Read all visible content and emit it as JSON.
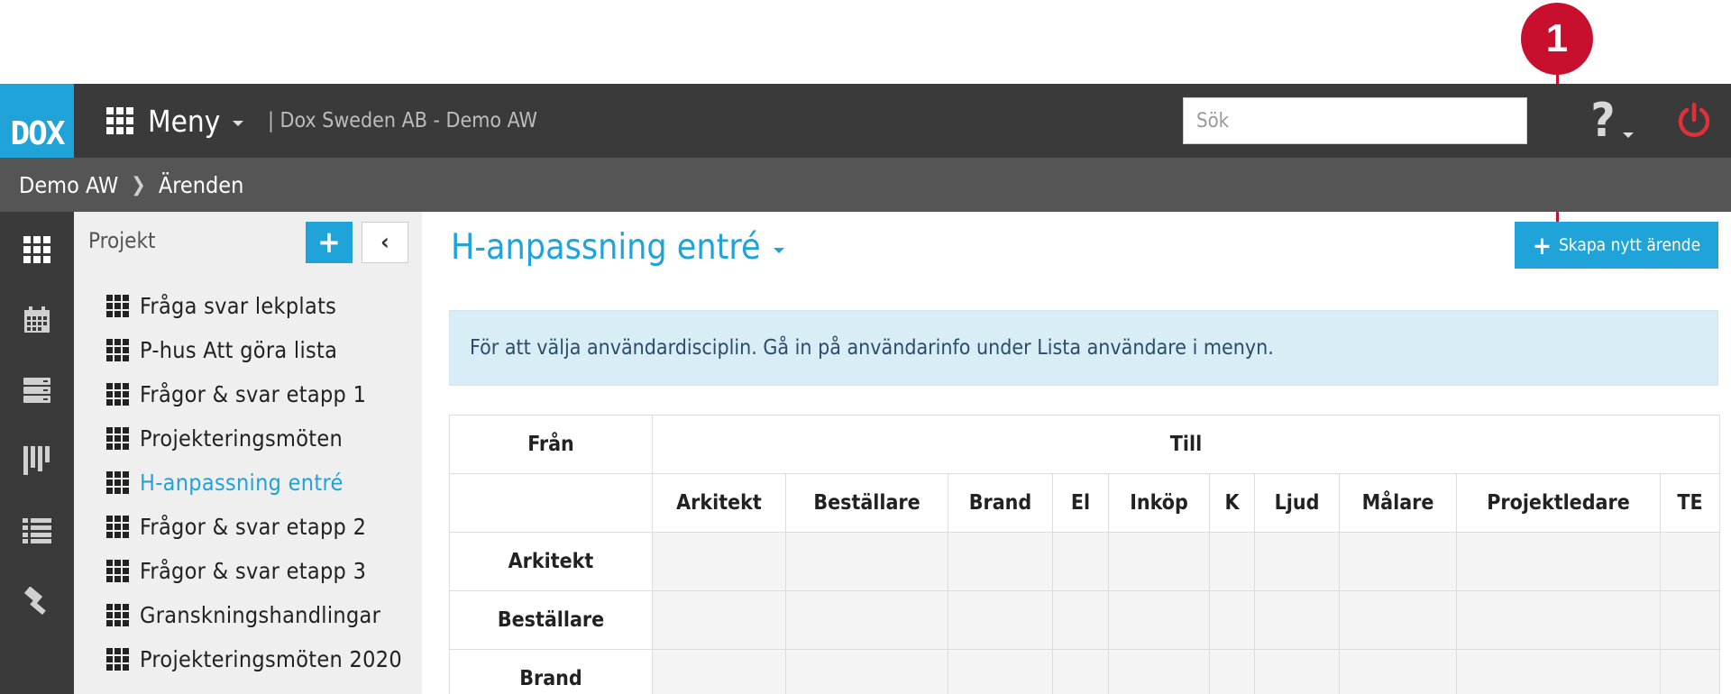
{
  "annotation": {
    "number": "1"
  },
  "topbar": {
    "logo": "DOX",
    "menu_label": "Meny",
    "org": "| Dox Sweden AB - Demo AW",
    "search_placeholder": "Sök",
    "help_symbol": "?"
  },
  "breadcrumb": {
    "items": [
      "Demo AW",
      "Ärenden"
    ]
  },
  "sidebar": {
    "title": "Projekt",
    "add_label": "+",
    "collapse_label": "‹",
    "items": [
      {
        "label": "Fråga svar lekplats",
        "active": false
      },
      {
        "label": "P-hus Att göra lista",
        "active": false
      },
      {
        "label": "Frågor & svar etapp 1",
        "active": false
      },
      {
        "label": "Projekteringsmöten",
        "active": false
      },
      {
        "label": "H-anpassning entré",
        "active": true
      },
      {
        "label": "Frågor & svar etapp 2",
        "active": false
      },
      {
        "label": "Frågor & svar etapp 3",
        "active": false
      },
      {
        "label": "Granskningshandlingar",
        "active": false
      },
      {
        "label": "Projekteringsmöten 2020",
        "active": false
      }
    ]
  },
  "rail": {
    "icons": [
      "grid-icon",
      "calendar-icon",
      "server-icon",
      "kanban-icon",
      "list-icon",
      "hammer-icon"
    ]
  },
  "main": {
    "title": "H-anpassning entré",
    "create_label": "Skapa nytt ärende",
    "info_text": "För att välja användardisciplin. Gå in på användarinfo under Lista användare i menyn."
  },
  "table": {
    "from_label": "Från",
    "to_label": "Till",
    "columns": [
      "Arkitekt",
      "Beställare",
      "Brand",
      "El",
      "Inköp",
      "K",
      "Ljud",
      "Målare",
      "Projektledare",
      "TE"
    ],
    "rows": [
      "Arkitekt",
      "Beställare",
      "Brand"
    ]
  },
  "colors": {
    "accent": "#1fa3d9",
    "topbar": "#3a3a3a",
    "crumbbar": "#555555",
    "marker": "#c8102e"
  }
}
